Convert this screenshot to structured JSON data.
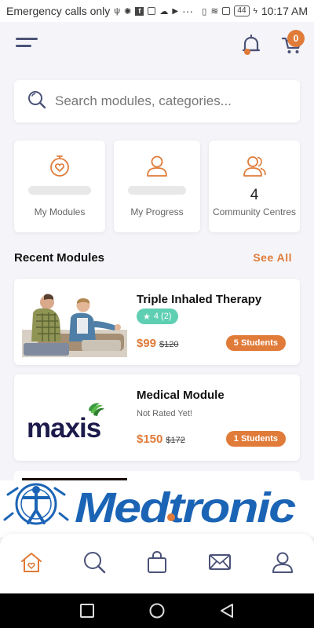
{
  "status_bar": {
    "carrier_text": "Emergency calls only",
    "battery": "44",
    "time": "10:17 AM"
  },
  "header": {
    "menu_icon": "hamburger-icon",
    "bell_icon": "bell-icon",
    "cart_icon": "cart-icon",
    "cart_count": "0"
  },
  "search": {
    "placeholder": "Search modules, categories..."
  },
  "tiles": [
    {
      "label": "My Modules",
      "icon": "heart-timer-icon"
    },
    {
      "label": "My Progress",
      "icon": "user-icon"
    },
    {
      "label": "Community Centres",
      "count": "4",
      "icon": "group-icon"
    }
  ],
  "recent": {
    "title": "Recent Modules",
    "see_all": "See All",
    "modules": [
      {
        "title": "Triple Inhaled Therapy",
        "rating": "4 (2)",
        "price": "$99",
        "old_price": "$120",
        "students": "5 Students"
      },
      {
        "title": "Medical Module",
        "rating_text": "Not Rated Yet!",
        "price": "$150",
        "old_price": "$172",
        "students": "1 Students",
        "logo_text": "maxis"
      }
    ]
  },
  "banner": {
    "brand": "Medtronic"
  },
  "bottom_nav": [
    "home-icon",
    "search-icon",
    "bag-icon",
    "mail-icon",
    "profile-icon"
  ],
  "colors": {
    "accent": "#e07b39",
    "rating_pill": "#5fcfb3",
    "nav_icon": "#4b5278",
    "medtronic_blue": "#1b64b5"
  }
}
